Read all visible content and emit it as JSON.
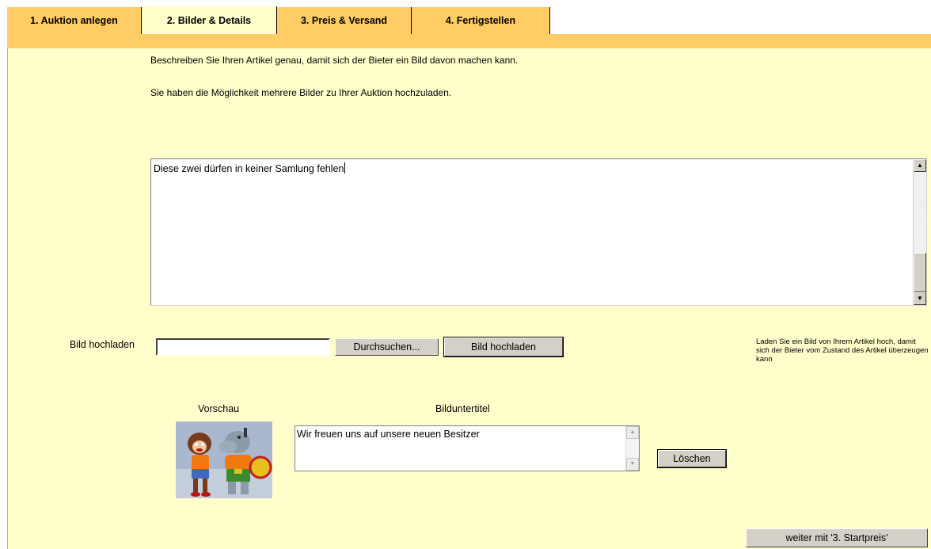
{
  "tabs": [
    {
      "label": "1. Auktion anlegen",
      "active": false
    },
    {
      "label": "2. Bilder & Details",
      "active": true
    },
    {
      "label": "3. Preis & Versand",
      "active": false
    },
    {
      "label": "4. Fertigstellen",
      "active": false
    }
  ],
  "intro": {
    "line1": "Beschreiben Sie Ihren Artikel genau, damit sich der Bieter ein Bild davon machen kann.",
    "line2": "Sie haben die Möglichkeit mehrere Bilder zu Ihrer Auktion hochzuladen."
  },
  "description": {
    "value": "Diese zwei dürfen in keiner Samlung fehlen"
  },
  "upload": {
    "label": "Bild hochladen",
    "file_value": "",
    "browse_label": "Durchsuchen...",
    "upload_button_label": "Bild hochladen",
    "help_text": "Laden Sie ein Bild von Ihrem Artikel hoch, damit sich der Bieter vom Zustand des Artikel überzeugen kann"
  },
  "preview": {
    "header": "Vorschau",
    "image_icon": "toy-figures-photo"
  },
  "caption": {
    "header": "Bilduntertitel",
    "value": "Wir freuen uns auf unsere neuen Besitzer",
    "delete_label": "Löschen"
  },
  "next_button_label": "weiter mit '3. Startpreis'",
  "colors": {
    "tab_orange": "#ffcc66",
    "panel_bg": "#ffffcc",
    "button_gray": "#d4d0c8"
  }
}
